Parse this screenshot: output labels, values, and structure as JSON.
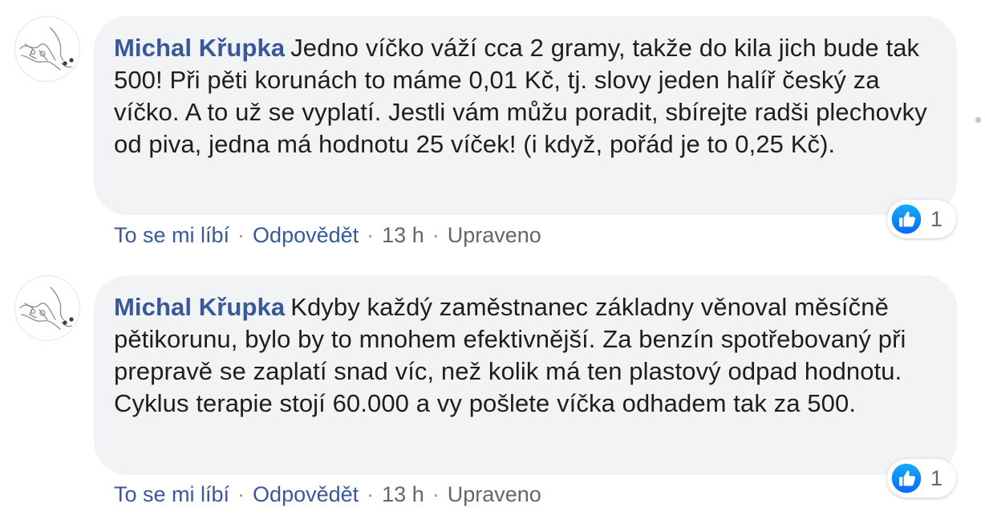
{
  "comments": [
    {
      "author": "Michal Křupka",
      "text": "Jedno víčko váží cca 2 gramy, takže do kila jich bude tak 500! Při pěti korunách to máme 0,01 Kč, tj. slovy jeden halíř český za víčko. A to už se vyplatí. Jestli vám můžu poradit, sbírejte radši plechovky od piva, jedna má hodnotu 25 víček! (i když, pořád je to 0,25 Kč).",
      "like_label": "To se mi líbí",
      "reply_label": "Odpovědět",
      "time": "13 h",
      "edited": "Upraveno",
      "reaction_icon": "like-icon",
      "reaction_count": "1"
    },
    {
      "author": "Michal Křupka",
      "text": "Kdyby každý zaměstnanec základny věnoval měsíčně pětikorunu, bylo by to mnohem efektivnější. Za benzín spotřebovaný při prepravě se zaplatí snad víc, než kolik má ten plastový odpad hodnotu. Cyklus terapie stojí 60.000 a vy pošlete víčka odhadem tak za 500.",
      "like_label": "To se mi líbí",
      "reply_label": "Odpovědět",
      "time": "13 h",
      "edited": "Upraveno",
      "reaction_icon": "like-icon",
      "reaction_count": "1"
    }
  ],
  "separator": "·",
  "colors": {
    "author": "#385898",
    "bubble": "#f2f3f5",
    "meta": "#606770",
    "like_blue": "#1877f2"
  }
}
